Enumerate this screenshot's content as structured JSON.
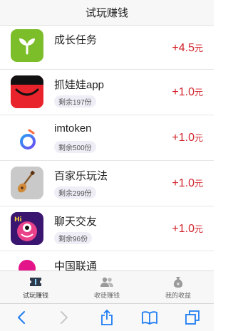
{
  "header": {
    "title": "试玩赚钱"
  },
  "apps": [
    {
      "name": "成长任务",
      "remain": "",
      "reward_sign": "+",
      "reward_value": "4.5",
      "reward_unit": "元",
      "icon": "sprout-icon"
    },
    {
      "name": "抓娃娃app",
      "remain": "剩余197份",
      "reward_sign": "+",
      "reward_value": "1.0",
      "reward_unit": "元",
      "icon": "claw-machine-icon"
    },
    {
      "name": "imtoken",
      "remain": "剩余500份",
      "reward_sign": "+",
      "reward_value": "1.0",
      "reward_unit": "元",
      "icon": "imtoken-icon"
    },
    {
      "name": "百家乐玩法",
      "remain": "剩余299份",
      "reward_sign": "+",
      "reward_value": "1.0",
      "reward_unit": "元",
      "icon": "guitar-icon"
    },
    {
      "name": "聊天交友",
      "remain": "剩余96份",
      "reward_sign": "+",
      "reward_value": "1.0",
      "reward_unit": "元",
      "icon": "monster-icon"
    },
    {
      "name": "中国联通",
      "remain": "",
      "reward_sign": "",
      "reward_value": "",
      "reward_unit": "",
      "icon": "unicom-icon"
    }
  ],
  "tabs": [
    {
      "label": "试玩赚钱",
      "icon": "ticket-icon",
      "active": true
    },
    {
      "label": "收徒赚钱",
      "icon": "users-icon",
      "active": false
    },
    {
      "label": "我的收益",
      "icon": "money-bag-icon",
      "active": false
    }
  ],
  "colors": {
    "reward": "#d0212a",
    "badge_bg": "#efedf6",
    "accent_green": "#7cbd2a",
    "accent_blue": "#1e90f7"
  }
}
